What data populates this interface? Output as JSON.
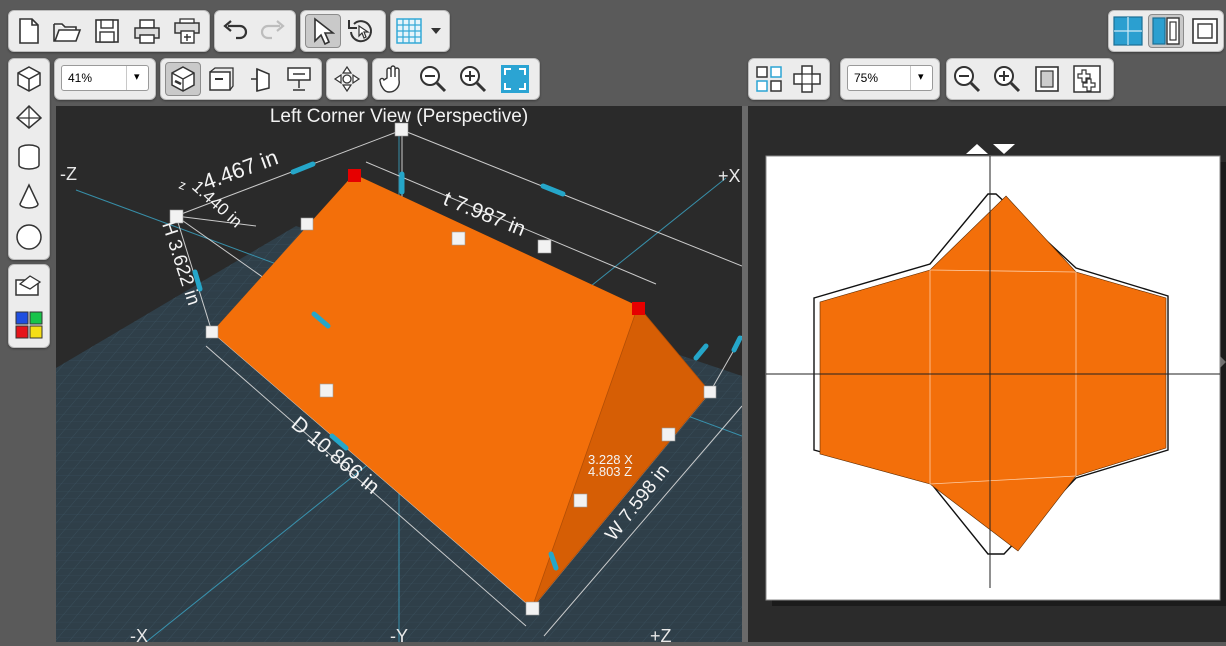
{
  "view": {
    "title": "Left Corner View (Perspective)",
    "axes": {
      "neg_z": "-Z",
      "pos_x": "+X",
      "neg_x": "-X",
      "neg_y": "-Y",
      "pos_z": "+Z"
    }
  },
  "zoom_left": {
    "value": "41%"
  },
  "zoom_right": {
    "value": "75%"
  },
  "dimensions": {
    "top_front": "4.467 in",
    "top_back": "t 7.987 in",
    "small_label_a": "z",
    "small_label_b": "1.440 in",
    "height": "H 3.622 in",
    "depth": "D 10.866 in",
    "width": "W 7.598 in",
    "coord_line1": "3.228 X",
    "coord_line2": "4.803 Z"
  },
  "colors": {
    "model": "#f36f0a",
    "model_shade": "#d75f05",
    "accent": "#25a6c9",
    "corner_handle": "#e60000"
  },
  "icons": {
    "toolbar_file": [
      "new-file-icon",
      "open-folder-icon",
      "save-icon",
      "print-icon",
      "print-setup-icon"
    ],
    "toolbar_edit": [
      "undo-icon",
      "redo-icon"
    ],
    "toolbar_tools": [
      "select-arrow-icon",
      "rotate-icon"
    ],
    "toolbar_grid": [
      "grid-icon",
      "dropdown-arrow-icon"
    ],
    "layout": [
      "single-view-icon",
      "split-view-icon",
      "flat-view-icon"
    ],
    "shapes": [
      "cube-icon",
      "prism-icon",
      "cylinder-icon",
      "cone-icon",
      "sphere-icon"
    ],
    "extras": [
      "open-model-icon",
      "color-palette-icon"
    ]
  }
}
